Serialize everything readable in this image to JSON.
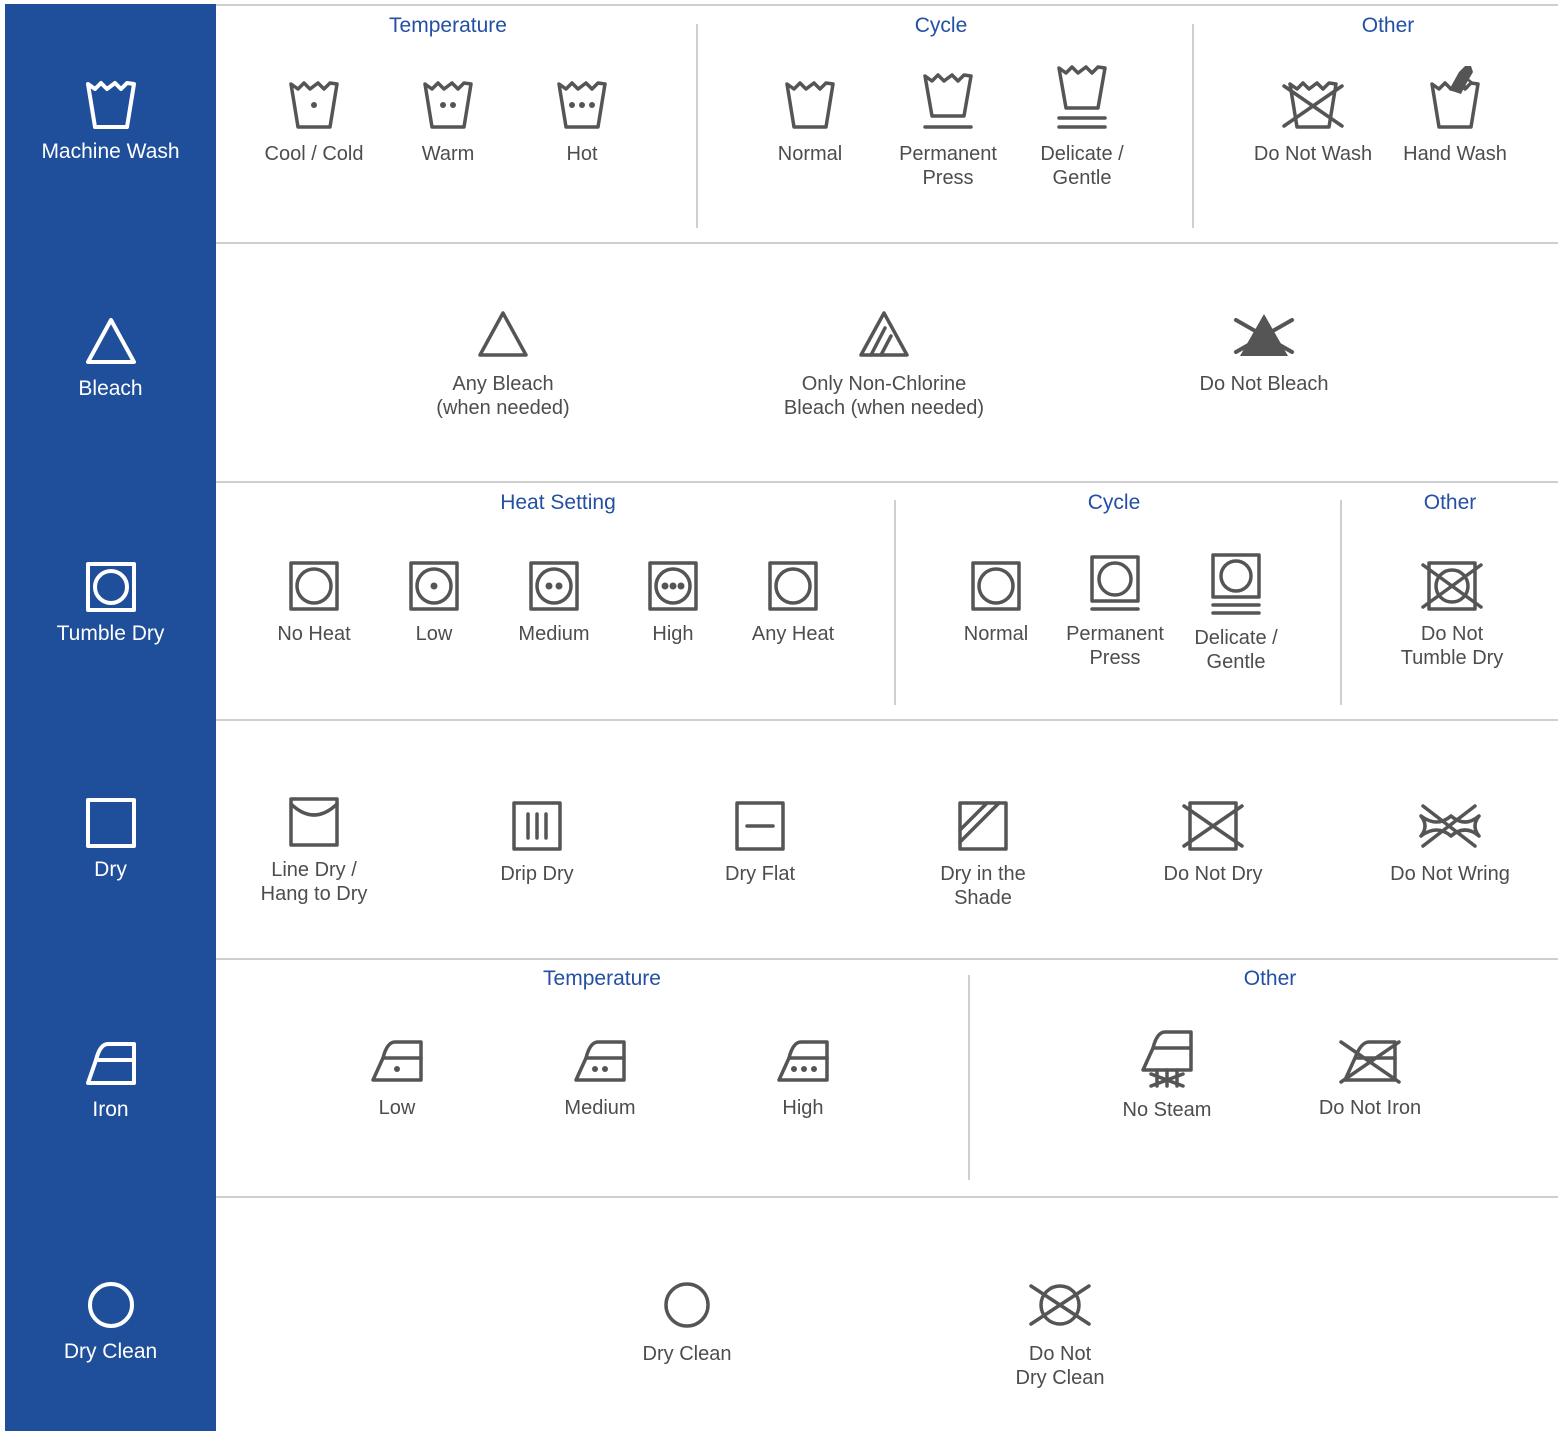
{
  "categories": {
    "machine_wash": "Machine Wash",
    "bleach": "Bleach",
    "tumble_dry": "Tumble Dry",
    "dry": "Dry",
    "iron": "Iron",
    "dry_clean": "Dry Clean"
  },
  "machine_wash": {
    "temperature_title": "Temperature",
    "cycle_title": "Cycle",
    "other_title": "Other",
    "items": [
      "Cool  / Cold",
      "Warm",
      "Hot",
      "Normal",
      "Permanent\nPress",
      "Delicate /\nGentle",
      "Do Not Wash",
      "Hand Wash"
    ]
  },
  "bleach": {
    "items": [
      "Any Bleach\n(when needed)",
      "Only Non-Chlorine\nBleach (when needed)",
      "Do Not Bleach"
    ]
  },
  "tumble_dry": {
    "heat_title": "Heat Setting",
    "cycle_title": "Cycle",
    "other_title": "Other",
    "items": [
      "No Heat",
      "Low",
      "Medium",
      "High",
      "Any Heat",
      "Normal",
      "Permanent\nPress",
      "Delicate /\nGentle",
      "Do Not\nTumble Dry"
    ]
  },
  "dry": {
    "items": [
      "Line Dry /\nHang to Dry",
      "Drip Dry",
      "Dry Flat",
      "Dry in the\nShade",
      "Do Not Dry",
      "Do Not Wring"
    ]
  },
  "iron": {
    "temperature_title": "Temperature",
    "other_title": "Other",
    "items": [
      "Low",
      "Medium",
      "High",
      "No Steam",
      "Do Not Iron"
    ]
  },
  "dry_clean": {
    "items": [
      "Dry Clean",
      "Do Not\nDry Clean"
    ]
  }
}
